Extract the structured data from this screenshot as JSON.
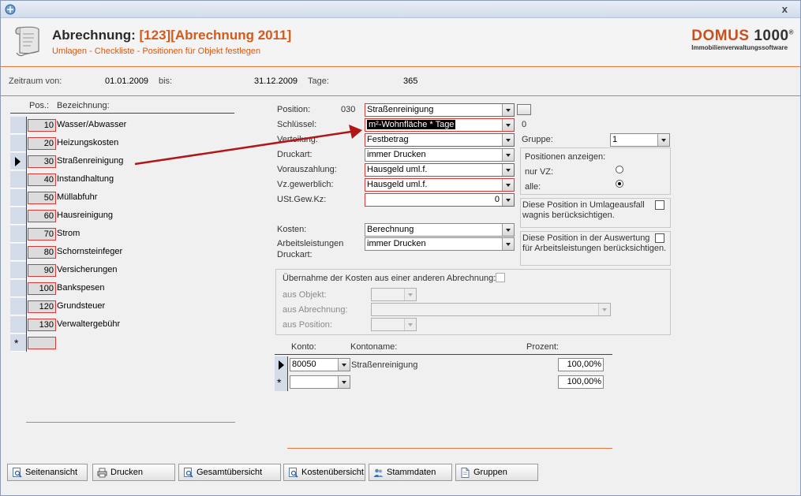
{
  "header": {
    "title_prefix": "Abrechnung:",
    "title_highlight": "[123][Abrechnung 2011]",
    "subtitle": "Umlagen - Checkliste - Positionen für Objekt festlegen",
    "logo_main_a": "DOMUS",
    "logo_main_b": "1000",
    "logo_reg": "®",
    "logo_sub": "Immobilienverwaltungssoftware",
    "close": "x"
  },
  "period": {
    "from_label": "Zeitraum von:",
    "from_value": "01.01.2009",
    "to_label": "bis:",
    "to_value": "31.12.2009",
    "days_label": "Tage:",
    "days_value": "365"
  },
  "positions": {
    "col_pos": "Pos.:",
    "col_bez": "Bezeichnung:",
    "rows": [
      {
        "pos": "10",
        "bez": "Wasser/Abwasser"
      },
      {
        "pos": "20",
        "bez": "Heizungskosten"
      },
      {
        "pos": "30",
        "bez": "Straßenreinigung"
      },
      {
        "pos": "40",
        "bez": "Instandhaltung"
      },
      {
        "pos": "50",
        "bez": "Müllabfuhr"
      },
      {
        "pos": "60",
        "bez": "Hausreinigung"
      },
      {
        "pos": "70",
        "bez": "Strom"
      },
      {
        "pos": "80",
        "bez": "Schornsteinfeger"
      },
      {
        "pos": "90",
        "bez": "Versicherungen"
      },
      {
        "pos": "100",
        "bez": "Bankspesen"
      },
      {
        "pos": "120",
        "bez": "Grundsteuer"
      },
      {
        "pos": "130",
        "bez": "Verwaltergebühr"
      }
    ],
    "new_row_marker": "*"
  },
  "form": {
    "position_label": "Position:",
    "position_num": "030",
    "position_value": "Straßenreinigung",
    "schluessel_label": "Schlüssel:",
    "schluessel_value": "m²-Wohnfläche * Tage",
    "schluessel_count": "0",
    "verteilung_label": "Verteilung:",
    "verteilung_value": "Festbetrag",
    "druckart_label": "Druckart:",
    "druckart_value": "immer Drucken",
    "vorauszahlung_label": "Vorauszahlung:",
    "vorauszahlung_value": "Hausgeld uml.f.",
    "vzgewerblich_label": "Vz.gewerblich:",
    "vzgewerblich_value": "Hausgeld uml.f.",
    "ust_label": "USt.Gew.Kz:",
    "ust_value": "0",
    "kosten_label": "Kosten:",
    "kosten_value": "Berechnung",
    "arbeit_label_1": "Arbeitsleistungen",
    "arbeit_label_2": "Druckart:",
    "arbeit_value": "immer Drucken",
    "gruppe_label": "Gruppe:",
    "gruppe_value": "1",
    "positionen_anzeigen": "Positionen anzeigen:",
    "nur_vz": "nur VZ:",
    "alle": "alle:",
    "umlage_text_1": "Diese Position in Umlageausfall",
    "umlage_text_2": "wagnis berücksichtigen.",
    "auswertung_text_1": "Diese Position in der Auswertung",
    "auswertung_text_2": "für Arbeitsleistungen berücksichtigen.",
    "uebernahme_label": "Übernahme der Kosten aus einer anderen Abrechnung:",
    "aus_objekt": "aus Objekt:",
    "aus_abrechnung": "aus Abrechnung:",
    "aus_position": "aus Position:"
  },
  "konto": {
    "col_konto": "Konto:",
    "col_name": "Kontoname:",
    "col_prozent": "Prozent:",
    "rows": [
      {
        "konto": "80050",
        "name": "Straßenreinigung",
        "prozent": "100,00%"
      }
    ],
    "new_row_prozent": "100,00%",
    "new_row_marker": "*"
  },
  "buttons": {
    "seitenansicht": "Seitenansicht",
    "drucken": "Drucken",
    "gesamtuebersicht": "Gesamtübersicht",
    "kostenuebersicht": "Kostenübersicht",
    "stammdaten": "Stammdaten",
    "gruppen": "Gruppen"
  },
  "colors": {
    "accent": "#d35a1a",
    "required_border": "#d43a3a",
    "annotation_arrow": "#b01818"
  }
}
